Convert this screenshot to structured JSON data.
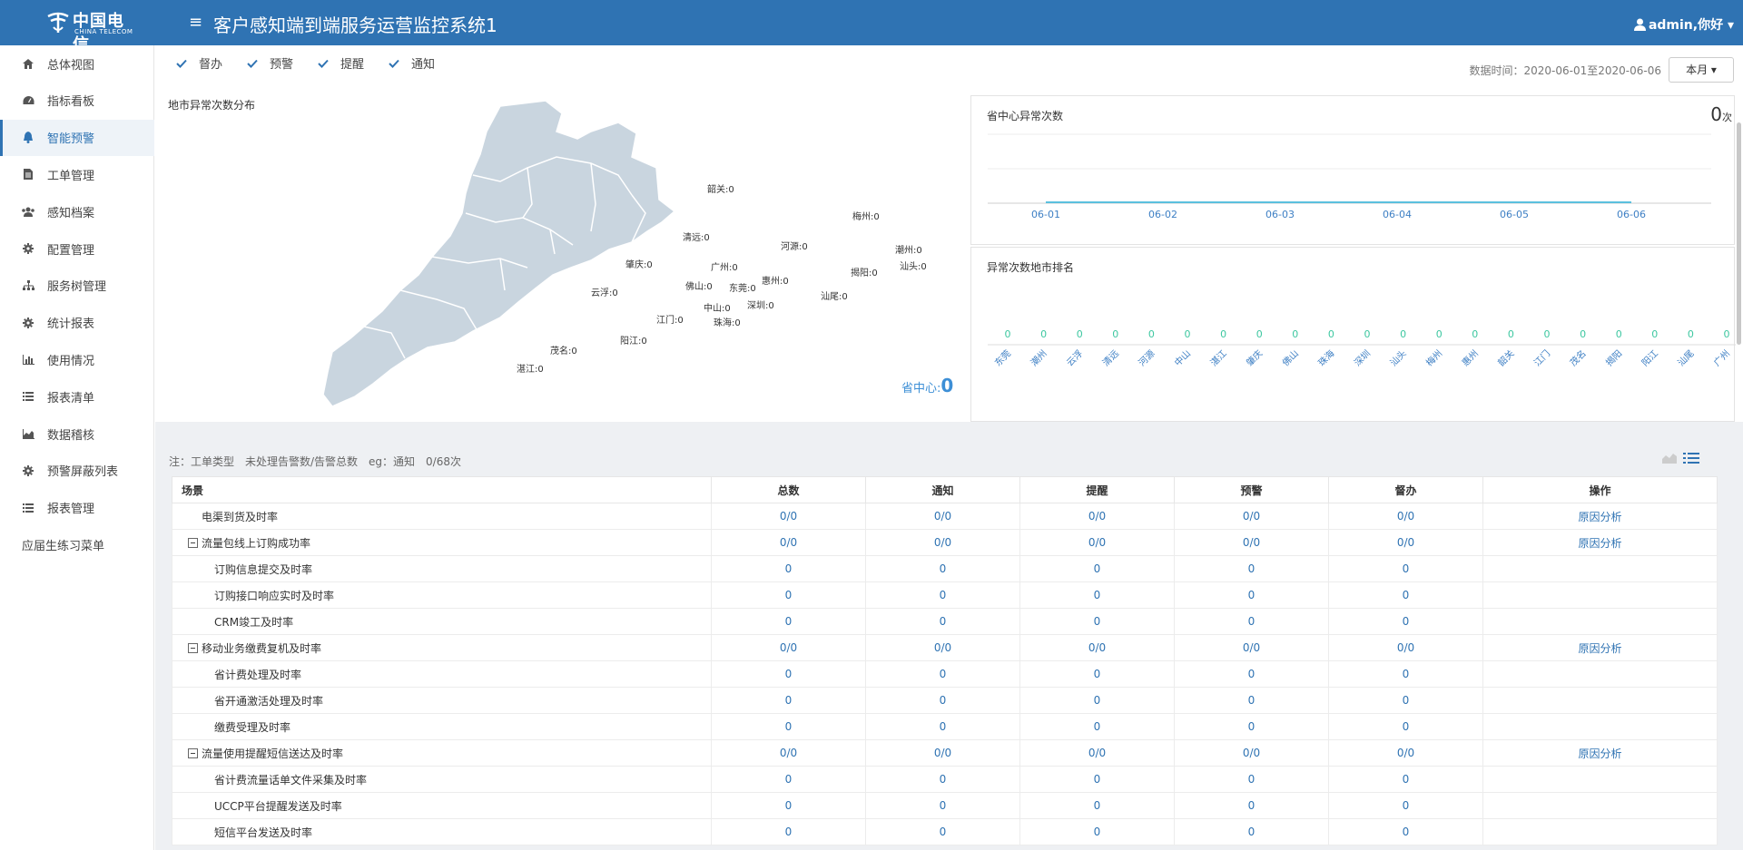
{
  "header": {
    "logo_cn": "中国电信",
    "logo_en": "CHINA TELECOM",
    "title": "客户感知端到端服务运营监控系统1",
    "user": "admin,你好",
    "menu_icon": "hamburger-icon",
    "user_icon": "user-icon"
  },
  "sidebar": {
    "items": [
      {
        "label": "总体视图",
        "icon": "home-icon"
      },
      {
        "label": "指标看板",
        "icon": "dashboard-icon"
      },
      {
        "label": "智能预警",
        "icon": "bell-icon",
        "active": true
      },
      {
        "label": "工单管理",
        "icon": "file-icon"
      },
      {
        "label": "感知档案",
        "icon": "users-icon"
      },
      {
        "label": "配置管理",
        "icon": "gear-icon"
      },
      {
        "label": "服务树管理",
        "icon": "sitemap-icon"
      },
      {
        "label": "统计报表",
        "icon": "gear-icon"
      },
      {
        "label": "使用情况",
        "icon": "bar-chart-icon"
      },
      {
        "label": "报表清单",
        "icon": "list-icon"
      },
      {
        "label": "数据稽核",
        "icon": "area-chart-icon"
      },
      {
        "label": "预警屏蔽列表",
        "icon": "gear-icon"
      },
      {
        "label": "报表管理",
        "icon": "list-icon"
      },
      {
        "label": "应届生练习菜单",
        "icon": ""
      }
    ]
  },
  "filters": {
    "checkboxes": [
      "督办",
      "预警",
      "提醒",
      "通知"
    ],
    "data_time": "数据时间：2020-06-01至2020-06-06",
    "period": "本月"
  },
  "map": {
    "title": "地市异常次数分布",
    "cities": [
      {
        "name": "韶关:0"
      },
      {
        "name": "梅州:0"
      },
      {
        "name": "清远:0"
      },
      {
        "name": "河源:0"
      },
      {
        "name": "潮州:0"
      },
      {
        "name": "汕头:0"
      },
      {
        "name": "揭阳:0"
      },
      {
        "name": "肇庆:0"
      },
      {
        "name": "广州:0"
      },
      {
        "name": "惠州:0"
      },
      {
        "name": "佛山:0"
      },
      {
        "name": "东莞:0"
      },
      {
        "name": "云浮:0"
      },
      {
        "name": "中山:0"
      },
      {
        "name": "深圳:0"
      },
      {
        "name": "汕尾:0"
      },
      {
        "name": "江门:0"
      },
      {
        "name": "珠海:0"
      },
      {
        "name": "阳江:0"
      },
      {
        "name": "茂名:0"
      },
      {
        "name": "湛江:0"
      }
    ],
    "province_center_label": "省中心:",
    "province_center_value": "0"
  },
  "province_chart": {
    "title": "省中心异常次数",
    "big_value": "0",
    "big_unit": "次",
    "x": [
      "06-01",
      "06-02",
      "06-03",
      "06-04",
      "06-05",
      "06-06"
    ],
    "values": [
      0,
      0,
      0,
      0,
      0,
      0
    ]
  },
  "city_rank_chart": {
    "title": "异常次数地市排名",
    "categories": [
      "东莞",
      "潮州",
      "云浮",
      "清远",
      "河源",
      "中山",
      "湛江",
      "肇庆",
      "佛山",
      "珠海",
      "深圳",
      "汕头",
      "梅州",
      "惠州",
      "韶关",
      "江门",
      "茂名",
      "揭阳",
      "阳江",
      "汕尾",
      "广州"
    ],
    "values": [
      0,
      0,
      0,
      0,
      0,
      0,
      0,
      0,
      0,
      0,
      0,
      0,
      0,
      0,
      0,
      0,
      0,
      0,
      0,
      0,
      0
    ]
  },
  "chart_data": [
    {
      "type": "line",
      "title": "省中心异常次数",
      "x": [
        "06-01",
        "06-02",
        "06-03",
        "06-04",
        "06-05",
        "06-06"
      ],
      "series": [
        {
          "values": [
            0,
            0,
            0,
            0,
            0,
            0
          ]
        }
      ]
    },
    {
      "type": "bar",
      "title": "异常次数地市排名",
      "categories": [
        "东莞",
        "潮州",
        "云浮",
        "清远",
        "河源",
        "中山",
        "湛江",
        "肇庆",
        "佛山",
        "珠海",
        "深圳",
        "汕头",
        "梅州",
        "惠州",
        "韶关",
        "江门",
        "茂名",
        "揭阳",
        "阳江",
        "汕尾",
        "广州"
      ],
      "values": [
        0,
        0,
        0,
        0,
        0,
        0,
        0,
        0,
        0,
        0,
        0,
        0,
        0,
        0,
        0,
        0,
        0,
        0,
        0,
        0,
        0
      ]
    }
  ],
  "table": {
    "note": "注：工单类型　未处理告警数/告警总数　eg：通知　0/68次",
    "headers": [
      "场景",
      "总数",
      "通知",
      "提醒",
      "预警",
      "督办",
      "操作"
    ],
    "rows": [
      {
        "scene": "电渠到货及时率",
        "level": 0,
        "toggle": false,
        "cells": [
          "0/0",
          "0/0",
          "0/0",
          "0/0",
          "0/0"
        ],
        "action": "原因分析"
      },
      {
        "scene": "流量包线上订购成功率",
        "level": 0,
        "toggle": true,
        "cells": [
          "0/0",
          "0/0",
          "0/0",
          "0/0",
          "0/0"
        ],
        "action": "原因分析"
      },
      {
        "scene": "订购信息提交及时率",
        "level": 1,
        "toggle": false,
        "cells": [
          "0",
          "0",
          "0",
          "0",
          "0"
        ],
        "action": ""
      },
      {
        "scene": "订购接口响应实时及时率",
        "level": 1,
        "toggle": false,
        "cells": [
          "0",
          "0",
          "0",
          "0",
          "0"
        ],
        "action": ""
      },
      {
        "scene": "CRM竣工及时率",
        "level": 1,
        "toggle": false,
        "cells": [
          "0",
          "0",
          "0",
          "0",
          "0"
        ],
        "action": ""
      },
      {
        "scene": "移动业务缴费复机及时率",
        "level": 0,
        "toggle": true,
        "cells": [
          "0/0",
          "0/0",
          "0/0",
          "0/0",
          "0/0"
        ],
        "action": "原因分析"
      },
      {
        "scene": "省计费处理及时率",
        "level": 1,
        "toggle": false,
        "cells": [
          "0",
          "0",
          "0",
          "0",
          "0"
        ],
        "action": ""
      },
      {
        "scene": "省开通激活处理及时率",
        "level": 1,
        "toggle": false,
        "cells": [
          "0",
          "0",
          "0",
          "0",
          "0"
        ],
        "action": ""
      },
      {
        "scene": "缴费受理及时率",
        "level": 1,
        "toggle": false,
        "cells": [
          "0",
          "0",
          "0",
          "0",
          "0"
        ],
        "action": ""
      },
      {
        "scene": "流量使用提醒短信送达及时率",
        "level": 0,
        "toggle": true,
        "cells": [
          "0/0",
          "0/0",
          "0/0",
          "0/0",
          "0/0"
        ],
        "action": "原因分析"
      },
      {
        "scene": "省计费流量话单文件采集及时率",
        "level": 1,
        "toggle": false,
        "cells": [
          "0",
          "0",
          "0",
          "0",
          "0"
        ],
        "action": ""
      },
      {
        "scene": "UCCP平台提醒发送及时率",
        "level": 1,
        "toggle": false,
        "cells": [
          "0",
          "0",
          "0",
          "0",
          "0"
        ],
        "action": ""
      },
      {
        "scene": "短信平台发送及时率",
        "level": 1,
        "toggle": false,
        "cells": [
          "0",
          "0",
          "0",
          "0",
          "0"
        ],
        "action": ""
      }
    ]
  },
  "colors": {
    "primary": "#2f73b3",
    "map_fill": "#c9d5df",
    "chart_line": "#5bc0de",
    "rank_value": "#3dc7a0"
  }
}
